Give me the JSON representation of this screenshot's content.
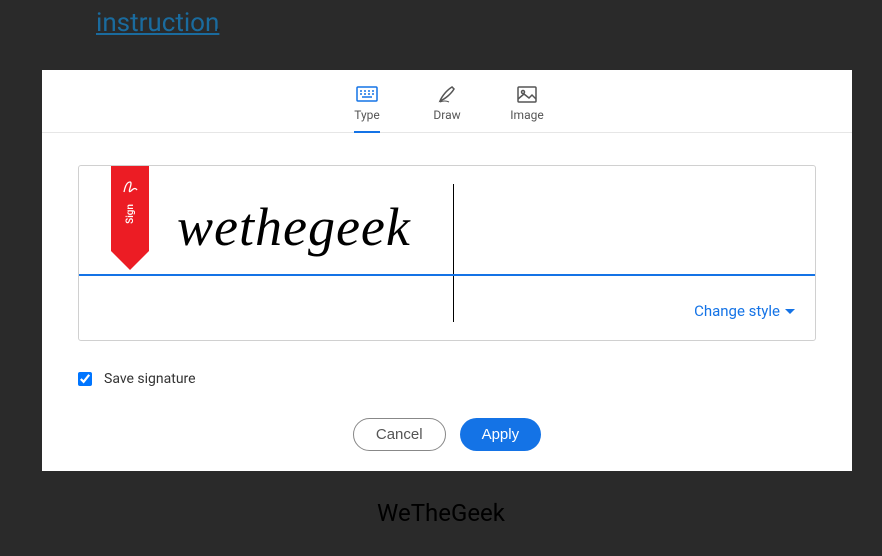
{
  "background": {
    "link_text": "instruction",
    "watermark": "WeTheGeek"
  },
  "dialog": {
    "tabs": [
      {
        "label": "Type",
        "active": true
      },
      {
        "label": "Draw",
        "active": false
      },
      {
        "label": "Image",
        "active": false
      }
    ],
    "sign_tag_text": "Sign",
    "signature_text": "wethegeek",
    "change_style_label": "Change style",
    "save_signature_label": "Save signature",
    "save_signature_checked": true,
    "buttons": {
      "cancel": "Cancel",
      "apply": "Apply"
    }
  },
  "colors": {
    "primary": "#1473e6",
    "accent_red": "#ec1c24"
  }
}
